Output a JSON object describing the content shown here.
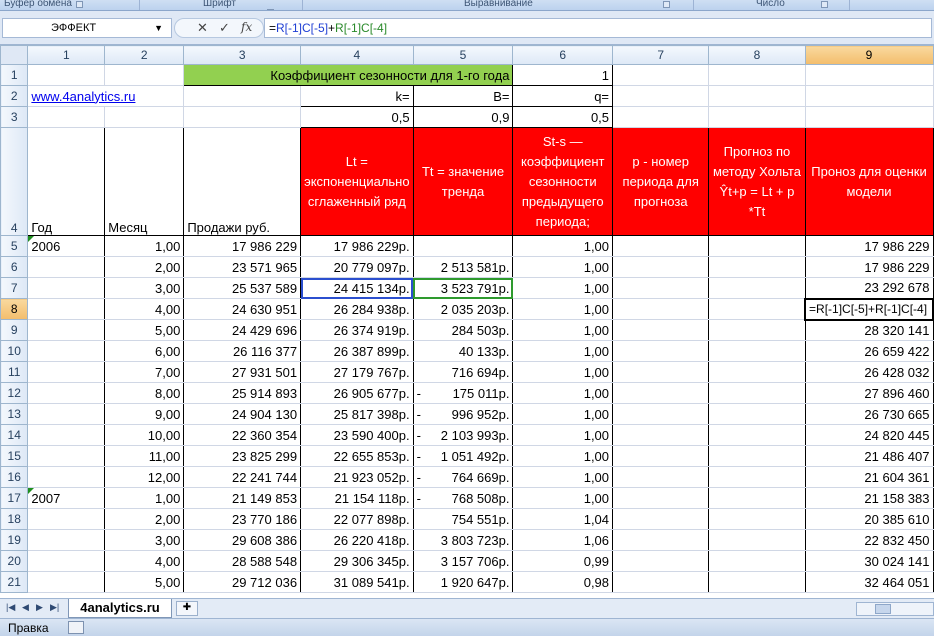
{
  "ribbon": {
    "groups": [
      "Буфер обмена",
      "Шрифт",
      "Выравнивание",
      "Число"
    ]
  },
  "formula_bar": {
    "name_box": "ЭФФЕКТ",
    "cancel_glyph": "✕",
    "enter_glyph": "✓",
    "fx_glyph": "fx",
    "formula_prefix": "=",
    "formula_ref1": "R[-1]C[-5]",
    "formula_plus": "+",
    "formula_ref2": "R[-1]C[-4]"
  },
  "columns": [
    "1",
    "2",
    "3",
    "4",
    "5",
    "6",
    "7",
    "8",
    "9"
  ],
  "rows": {
    "r1": {
      "num": "1",
      "title": "Коэффициент сезонности для 1-го года",
      "c6": "1"
    },
    "r2": {
      "num": "2",
      "link": "www.4analytics.ru",
      "c4": "k=",
      "c5": "B=",
      "c6": "q="
    },
    "r3": {
      "num": "3",
      "c4": "0,5",
      "c5": "0,9",
      "c6": "0,5"
    },
    "r4": {
      "num": "4",
      "c1": "Год",
      "c2": "Месяц",
      "c3": "Продажи руб.",
      "c4": "Lt = экспоненциально сглаженный ряд",
      "c5": "Tt = значение тренда",
      "c6": "St-s  — коэффициент сезонности предыдущего периода;",
      "c7": "p - номер периода для прогноза",
      "c8": "Прогноз по методу Хольта Ŷt+p = Lt + p *Tt",
      "c9": "Пронoз для оценки модели"
    },
    "data": [
      {
        "num": "5",
        "year": "2006",
        "month": "1,00",
        "sales": "17 986 229",
        "lt": "17 986 229р.",
        "tt": "",
        "tt_dash": "",
        "st": "1,00",
        "c9": "17 986 229"
      },
      {
        "num": "6",
        "year": "",
        "month": "2,00",
        "sales": "23 571 965",
        "lt": "20 779 097р.",
        "tt": "2 513 581р.",
        "tt_dash": "",
        "st": "1,00",
        "c9": "17 986 229"
      },
      {
        "num": "7",
        "year": "",
        "month": "3,00",
        "sales": "25 537 589",
        "lt": "24 415 134р.",
        "tt": "3 523 791р.",
        "tt_dash": "",
        "st": "1,00",
        "c9": "23 292 678"
      },
      {
        "num": "8",
        "year": "",
        "month": "4,00",
        "sales": "24 630 951",
        "lt": "26 284 938р.",
        "tt": "2 035 203р.",
        "tt_dash": "",
        "st": "1,00",
        "c9": "=R[-1]C[-5]+R[-1]C[-4]"
      },
      {
        "num": "9",
        "year": "",
        "month": "5,00",
        "sales": "24 429 696",
        "lt": "26 374 919р.",
        "tt": "284 503р.",
        "tt_dash": "",
        "st": "1,00",
        "c9": "28 320 141"
      },
      {
        "num": "10",
        "year": "",
        "month": "6,00",
        "sales": "26 116 377",
        "lt": "26 387 899р.",
        "tt": "40 133р.",
        "tt_dash": "",
        "st": "1,00",
        "c9": "26 659 422"
      },
      {
        "num": "11",
        "year": "",
        "month": "7,00",
        "sales": "27 931 501",
        "lt": "27 179 767р.",
        "tt": "716 694р.",
        "tt_dash": "",
        "st": "1,00",
        "c9": "26 428 032"
      },
      {
        "num": "12",
        "year": "",
        "month": "8,00",
        "sales": "25 914 893",
        "lt": "26 905 677р.",
        "tt": "175 011р.",
        "tt_dash": "-",
        "st": "1,00",
        "c9": "27 896 460"
      },
      {
        "num": "13",
        "year": "",
        "month": "9,00",
        "sales": "24 904 130",
        "lt": "25 817 398р.",
        "tt": "996 952р.",
        "tt_dash": "-",
        "st": "1,00",
        "c9": "26 730 665"
      },
      {
        "num": "14",
        "year": "",
        "month": "10,00",
        "sales": "22 360 354",
        "lt": "23 590 400р.",
        "tt": "2 103 993р.",
        "tt_dash": "-",
        "st": "1,00",
        "c9": "24 820 445"
      },
      {
        "num": "15",
        "year": "",
        "month": "11,00",
        "sales": "23 825 299",
        "lt": "22 655 853р.",
        "tt": "1 051 492р.",
        "tt_dash": "-",
        "st": "1,00",
        "c9": "21 486 407"
      },
      {
        "num": "16",
        "year": "",
        "month": "12,00",
        "sales": "22 241 744",
        "lt": "21 923 052р.",
        "tt": "764 669р.",
        "tt_dash": "-",
        "st": "1,00",
        "c9": "21 604 361"
      },
      {
        "num": "17",
        "year": "2007",
        "month": "1,00",
        "sales": "21 149 853",
        "lt": "21 154 118р.",
        "tt": "768 508р.",
        "tt_dash": "-",
        "st": "1,00",
        "c9": "21 158 383"
      },
      {
        "num": "18",
        "year": "",
        "month": "2,00",
        "sales": "23 770 186",
        "lt": "22 077 898р.",
        "tt": "754 551р.",
        "tt_dash": "",
        "st": "1,04",
        "c9": "20 385 610"
      },
      {
        "num": "19",
        "year": "",
        "month": "3,00",
        "sales": "29 608 386",
        "lt": "26 220 418р.",
        "tt": "3 803 723р.",
        "tt_dash": "",
        "st": "1,06",
        "c9": "22 832 450"
      },
      {
        "num": "20",
        "year": "",
        "month": "4,00",
        "sales": "28 588 548",
        "lt": "29 306 345р.",
        "tt": "3 157 706р.",
        "tt_dash": "",
        "st": "0,99",
        "c9": "30 024 141"
      },
      {
        "num": "21",
        "year": "",
        "month": "5,00",
        "sales": "29 712 036",
        "lt": "31 089 541р.",
        "tt": "1 920 647р.",
        "tt_dash": "",
        "st": "0,98",
        "c9": "32 464 051"
      }
    ]
  },
  "sheet_tabs": {
    "active": "4analytics.ru"
  },
  "status_bar": {
    "mode": "Правка"
  }
}
